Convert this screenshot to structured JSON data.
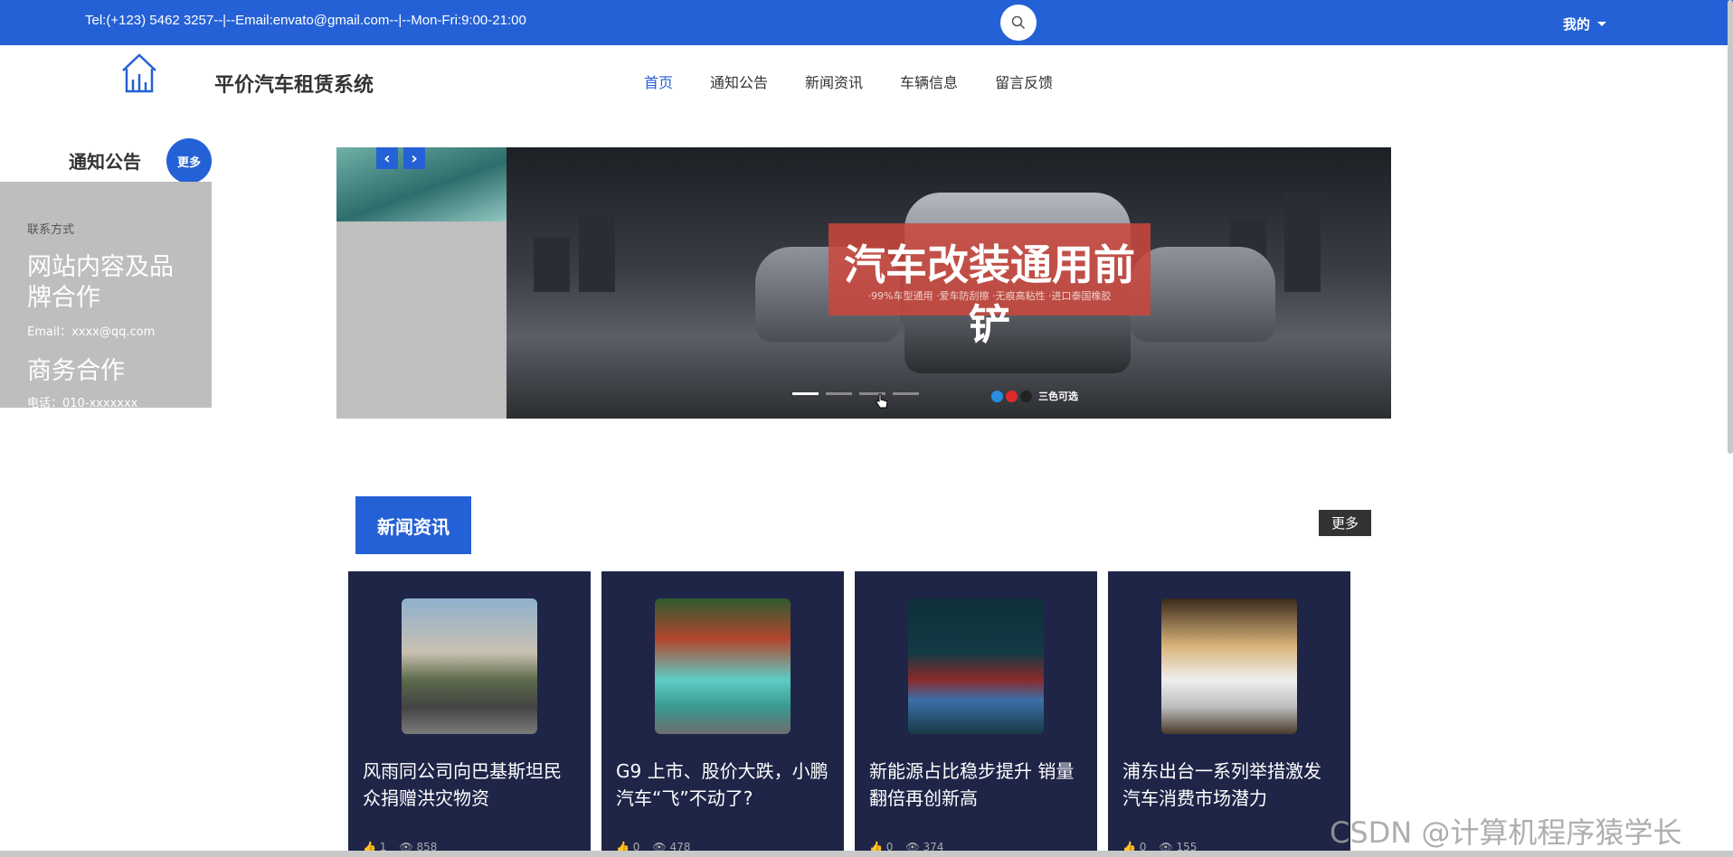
{
  "topbar": {
    "contact": "Tel:(+123) 5462 3257--|--Email:envato@gmail.com--|--Mon-Fri:9:00-21:00",
    "me_label": "我的"
  },
  "header": {
    "brand": "平价汽车租赁系统",
    "nav": [
      "首页",
      "通知公告",
      "新闻资讯",
      "车辆信息",
      "留言反馈"
    ],
    "active_nav": "首页"
  },
  "notice": {
    "title": "通知公告",
    "more_label": "更多",
    "contact_label": "联系方式",
    "headline1": "网站内容及品牌合作",
    "email": "Email：xxxx@qq.com",
    "headline2": "商务合作",
    "tel": "电话：010-xxxxxxx"
  },
  "banner": {
    "promo_title": "汽车改装通用前铲",
    "promo_sub": "·99%车型通用 ·爱车防刮擦 ·无痕高粘性 ·进口泰国橡胶",
    "colors_label": "三色可选",
    "swatch_colors": [
      "#2a8de0",
      "#e02a2a",
      "#222222"
    ],
    "slide_count": 4,
    "active_slide": 0
  },
  "news": {
    "title": "新闻资讯",
    "more_label": "更多",
    "items": [
      {
        "title": "风雨同公司向巴基斯坦民众捐赠洪灾物资",
        "likes": "1",
        "views": "858"
      },
      {
        "title": "G9 上市、股价大跌，小鹏汽车“飞”不动了?",
        "likes": "0",
        "views": "478"
      },
      {
        "title": "新能源占比稳步提升 销量翻倍再创新高",
        "likes": "0",
        "views": "374"
      },
      {
        "title": "浦东出台一系列举措激发汽车消费市场潜力",
        "likes": "0",
        "views": "155"
      }
    ]
  },
  "watermark": "CSDN @计算机程序猿学长",
  "colors": {
    "primary": "#2561d6",
    "card_bg": "#1f2547",
    "panel_gray": "#bebebe"
  }
}
